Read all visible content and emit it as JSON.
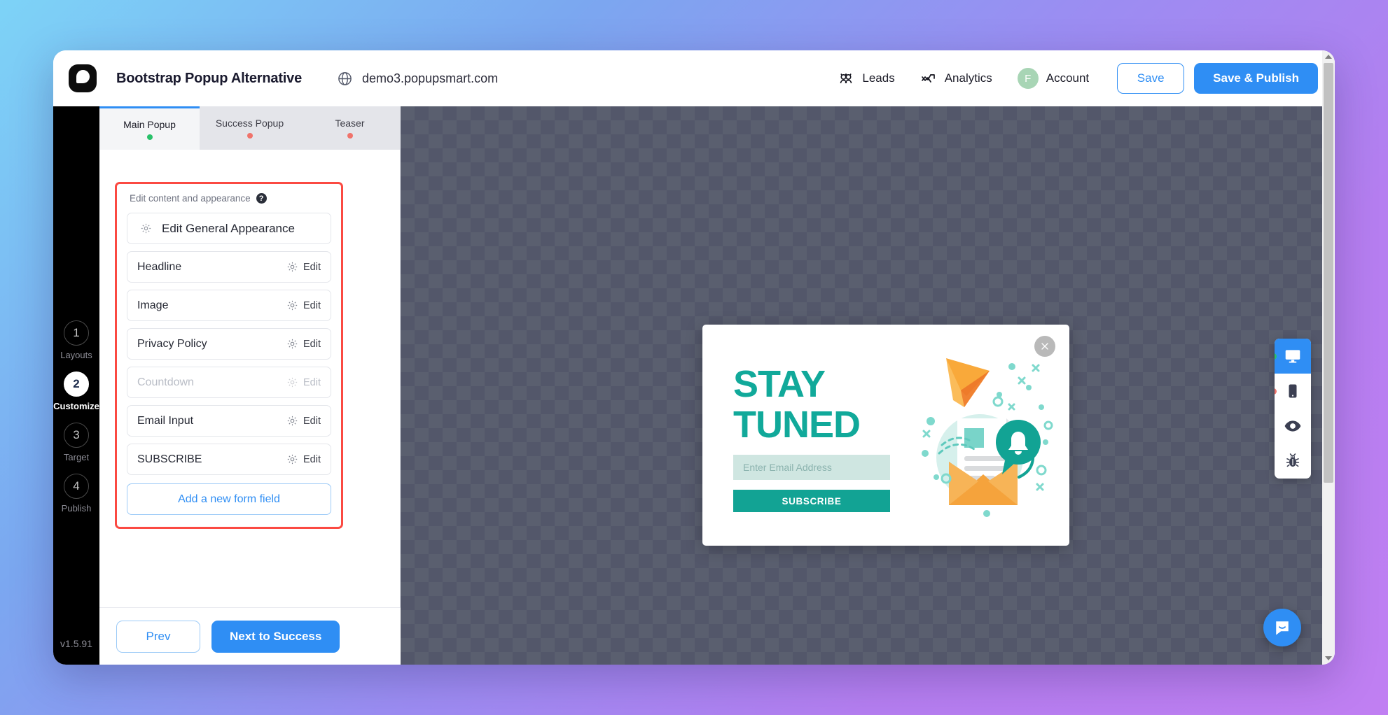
{
  "header": {
    "logo_icon": "popupsmart-logo-icon",
    "project_title": "Bootstrap Popup Alternative",
    "globe_icon": "globe-icon",
    "domain": "demo3.popupsmart.com",
    "leads_label": "Leads",
    "leads_icon": "leads-people-icon",
    "analytics_label": "Analytics",
    "analytics_icon": "analytics-trend-icon",
    "account_label": "Account",
    "account_initial": "F",
    "save_label": "Save",
    "publish_label": "Save & Publish",
    "accent_blue": "#2f8ef4",
    "avatar_color": "#a8d5b5"
  },
  "steps": [
    {
      "number": "1",
      "label": "Layouts",
      "active": false
    },
    {
      "number": "2",
      "label": "Customize",
      "active": true
    },
    {
      "number": "3",
      "label": "Target",
      "active": false
    },
    {
      "number": "4",
      "label": "Publish",
      "active": false
    }
  ],
  "version": "v1.5.91",
  "tabs": [
    {
      "label": "Main Popup",
      "status": "green",
      "active": true
    },
    {
      "label": "Success Popup",
      "status": "red",
      "active": false
    },
    {
      "label": "Teaser",
      "status": "red",
      "active": false
    }
  ],
  "panel": {
    "section_title": "Edit content and appearance",
    "help_icon": "question-mark-icon",
    "highlight_color": "#fb4a42",
    "general_appearance_label": "Edit General Appearance",
    "gear_icon": "gear-icon",
    "edit_label": "Edit",
    "fields": [
      {
        "label": "Headline",
        "edit_label": "Edit",
        "disabled": false
      },
      {
        "label": "Image",
        "edit_label": "Edit",
        "disabled": false
      },
      {
        "label": "Privacy Policy",
        "edit_label": "Edit",
        "disabled": false
      },
      {
        "label": "Countdown",
        "edit_label": "Edit",
        "disabled": true
      },
      {
        "label": "Email Input",
        "edit_label": "Edit",
        "disabled": false
      },
      {
        "label": "SUBSCRIBE",
        "edit_label": "Edit",
        "disabled": false
      }
    ],
    "add_field_label": "Add a new form field",
    "prev_label": "Prev",
    "next_label": "Next to Success"
  },
  "popup": {
    "close_icon": "close-x-icon",
    "headline_line1": "STAY",
    "headline_line2": "TUNED",
    "email_placeholder": "Enter Email Address",
    "email_value": "",
    "subscribe_label": "SUBSCRIBE",
    "teal": "#11a99a",
    "input_bg": "#cfe6e1",
    "illustration": "envelope-paperplane-bell-illustration"
  },
  "device_toolbar": [
    {
      "icon": "desktop-monitor-icon",
      "active": true,
      "dot": "green"
    },
    {
      "icon": "mobile-phone-icon",
      "active": false,
      "dot": "red"
    },
    {
      "icon": "eye-preview-icon",
      "active": false,
      "dot": "none"
    },
    {
      "icon": "bug-debug-icon",
      "active": false,
      "dot": "none"
    }
  ],
  "intercom": {
    "icon": "chat-bubble-smile-icon"
  },
  "scrollbar": {
    "up_icon": "scroll-up-arrow-icon",
    "down_icon": "scroll-down-arrow-icon"
  }
}
